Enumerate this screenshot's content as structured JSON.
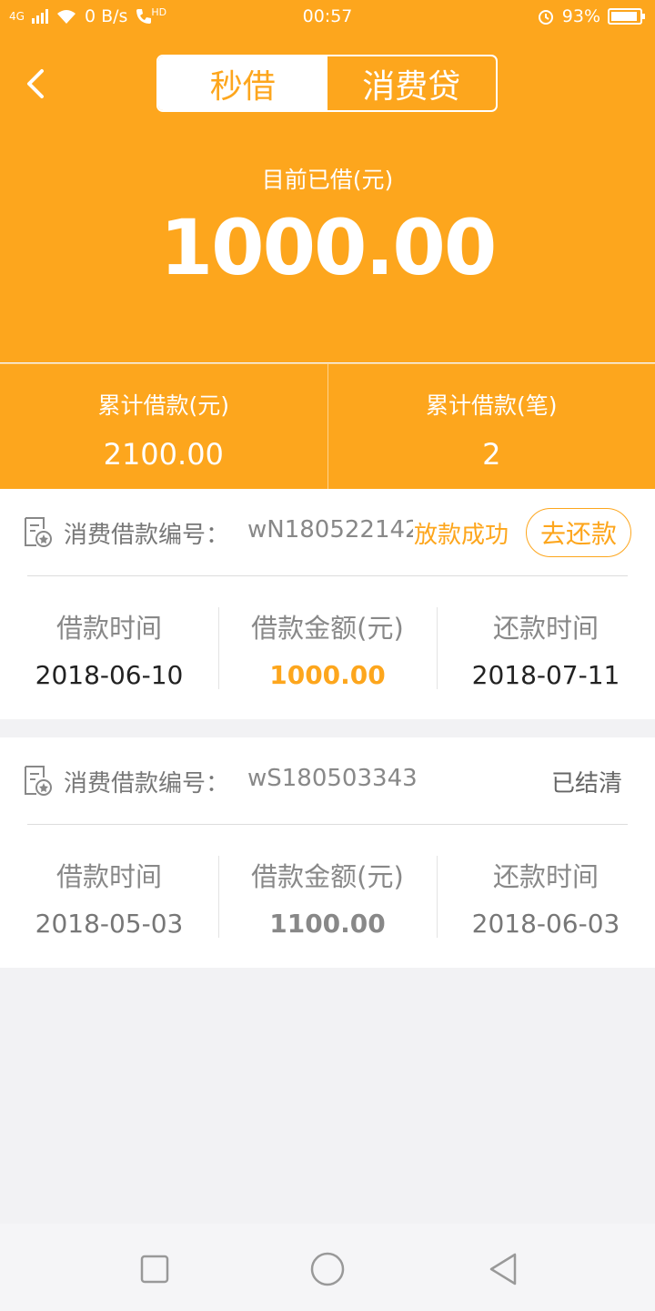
{
  "status_bar": {
    "network": "4G",
    "speed": "0 B/s",
    "call_badge": "HD",
    "time": "00:57",
    "battery": "93%",
    "battery_level": 0.93
  },
  "header": {
    "tabs": [
      {
        "label": "秒借",
        "active": true
      },
      {
        "label": "消费贷",
        "active": false
      }
    ],
    "current_label": "目前已借(元)",
    "current_amount": "1000.00"
  },
  "stats": [
    {
      "label": "累计借款(元)",
      "value": "2100.00"
    },
    {
      "label": "累计借款(笔)",
      "value": "2"
    }
  ],
  "loans": [
    {
      "order_label": "消费借款编号：",
      "order_no": "wN18052214223",
      "status": "放款成功",
      "action": "去还款",
      "columns": [
        {
          "label": "借款时间",
          "value": "2018-06-10"
        },
        {
          "label": "借款金额(元)",
          "value": "1000.00"
        },
        {
          "label": "还款时间",
          "value": "2018-07-11"
        }
      ]
    },
    {
      "order_label": "消费借款编号：",
      "order_no": "wS180503343",
      "status": "已结清",
      "columns": [
        {
          "label": "借款时间",
          "value": "2018-05-03"
        },
        {
          "label": "借款金额(元)",
          "value": "1100.00"
        },
        {
          "label": "还款时间",
          "value": "2018-06-03"
        }
      ]
    }
  ],
  "colors": {
    "accent": "#fda61d",
    "background": "#f2f2f4"
  },
  "icons": [
    "back-arrow-icon",
    "document-icon",
    "recent-apps-icon",
    "home-icon",
    "back-icon"
  ]
}
